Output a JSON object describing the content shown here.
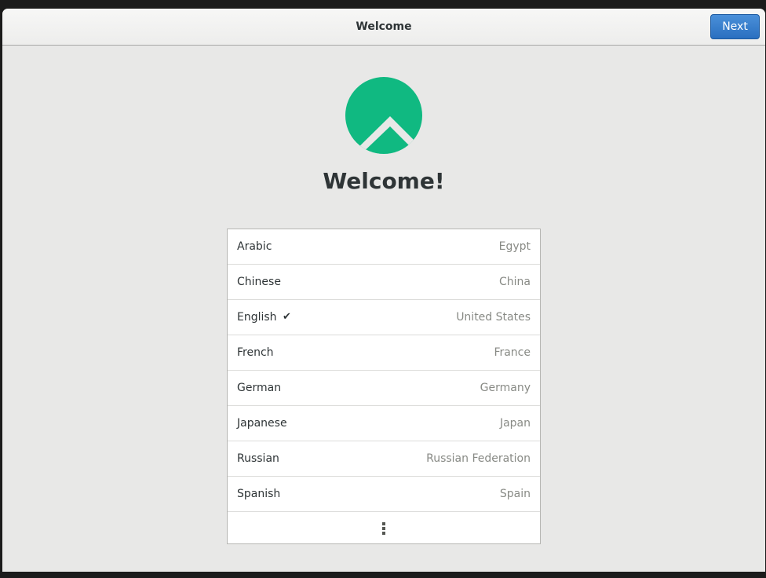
{
  "header": {
    "title": "Welcome",
    "next_label": "Next"
  },
  "main": {
    "heading": "Welcome!",
    "logo_icon": "rocky-linux-logo",
    "logo_color": "#10b981"
  },
  "languages": [
    {
      "name": "Arabic",
      "region": "Egypt",
      "selected": false,
      "check": ""
    },
    {
      "name": "Chinese",
      "region": "China",
      "selected": false,
      "check": ""
    },
    {
      "name": "English",
      "region": "United States",
      "selected": true,
      "check": "✔"
    },
    {
      "name": "French",
      "region": "France",
      "selected": false,
      "check": ""
    },
    {
      "name": "German",
      "region": "Germany",
      "selected": false,
      "check": ""
    },
    {
      "name": "Japanese",
      "region": "Japan",
      "selected": false,
      "check": ""
    },
    {
      "name": "Russian",
      "region": "Russian Federation",
      "selected": false,
      "check": ""
    },
    {
      "name": "Spanish",
      "region": "Spain",
      "selected": false,
      "check": ""
    }
  ],
  "more_icon": "more-vertical-icon",
  "colors": {
    "accent": "#3584e4",
    "logo": "#10b981"
  }
}
